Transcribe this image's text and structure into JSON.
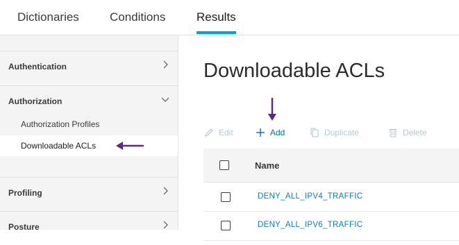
{
  "tabs": [
    {
      "label": "Dictionaries",
      "active": false
    },
    {
      "label": "Conditions",
      "active": false
    },
    {
      "label": "Results",
      "active": true
    }
  ],
  "sidebar": {
    "sections": [
      {
        "label": "Authentication",
        "expanded": false
      },
      {
        "label": "Authorization",
        "expanded": true,
        "items": [
          {
            "label": "Authorization Profiles",
            "selected": false
          },
          {
            "label": "Downloadable ACLs",
            "selected": true
          }
        ]
      },
      {
        "label": "Profiling",
        "expanded": false
      },
      {
        "label": "Posture",
        "expanded": false
      }
    ]
  },
  "main": {
    "title": "Downloadable ACLs",
    "toolbar": {
      "edit": "Edit",
      "add": "Add",
      "duplicate": "Duplicate",
      "delete": "Delete"
    },
    "table": {
      "columns": [
        "Name"
      ],
      "rows": [
        {
          "name": "DENY_ALL_IPV4_TRAFFIC"
        },
        {
          "name": "DENY_ALL_IPV6_TRAFFIC"
        }
      ]
    }
  },
  "colors": {
    "accent": "#049fd9",
    "link": "#0d7cb5",
    "annotation_arrow": "#5b2a86"
  }
}
